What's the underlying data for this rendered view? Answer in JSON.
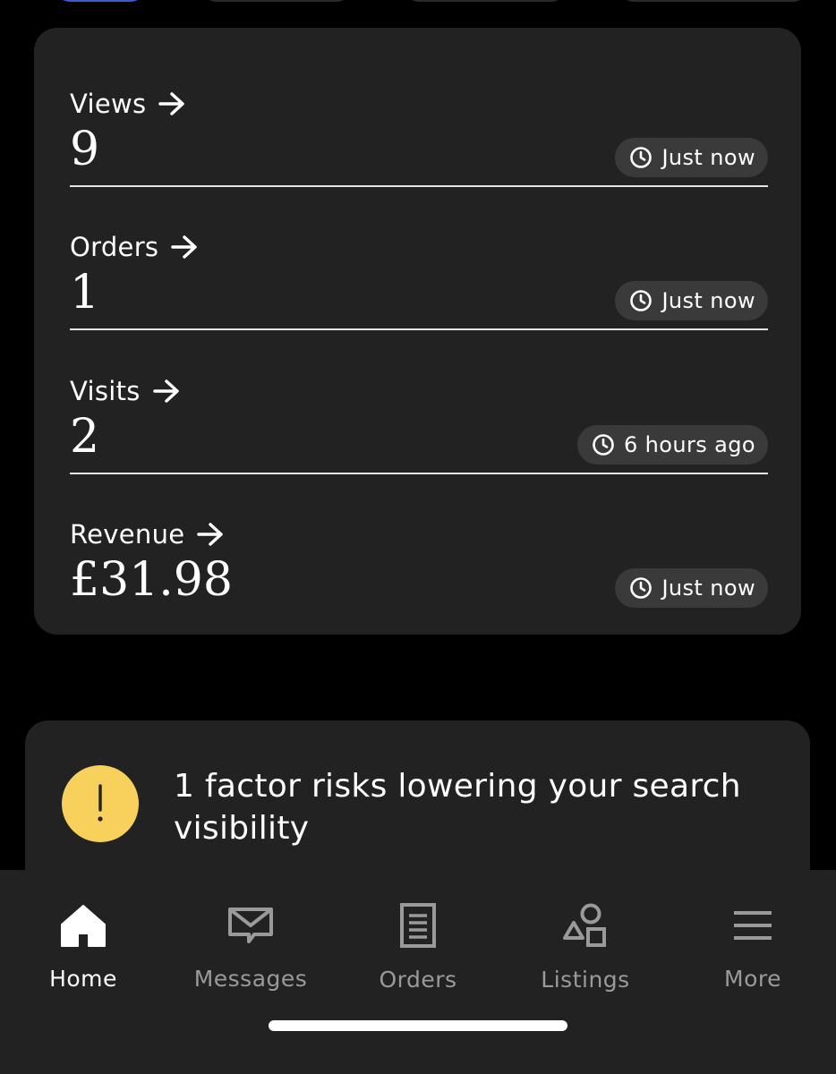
{
  "stats": [
    {
      "label": "Views",
      "value": "9",
      "time": "Just now"
    },
    {
      "label": "Orders",
      "value": "1",
      "time": "Just now"
    },
    {
      "label": "Visits",
      "value": "2",
      "time": "6 hours ago"
    },
    {
      "label": "Revenue",
      "value": "£31.98",
      "time": "Just now"
    }
  ],
  "risk": {
    "message": "1 factor risks lowering your search visibility",
    "icon": "exclamation-icon",
    "icon_color": "#f8d15c"
  },
  "nav": [
    {
      "label": "Home",
      "icon": "home-icon",
      "active": true
    },
    {
      "label": "Messages",
      "icon": "envelope-icon",
      "active": false
    },
    {
      "label": "Orders",
      "icon": "receipt-icon",
      "active": false
    },
    {
      "label": "Listings",
      "icon": "shapes-icon",
      "active": false
    },
    {
      "label": "More",
      "icon": "menu-icon",
      "active": false
    }
  ],
  "colors": {
    "background": "#000000",
    "card": "#222222",
    "pill": "#3a3a3a",
    "accent": "#3b5bd6",
    "inactive": "#9a9a9a"
  }
}
